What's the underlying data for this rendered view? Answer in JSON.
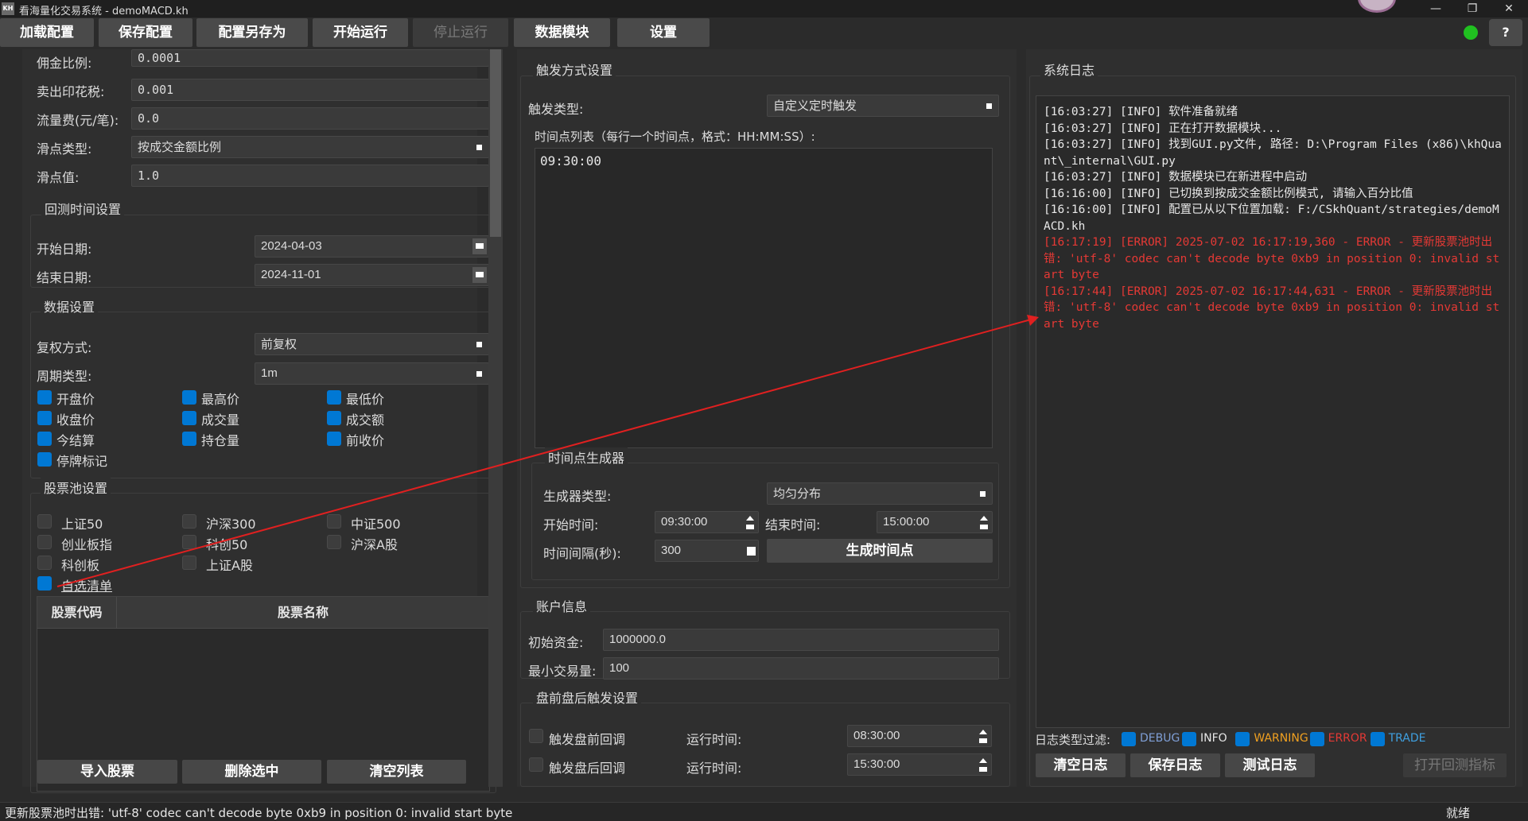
{
  "window": {
    "title": "看海量化交易系统 - demoMACD.kh",
    "app_icon": "KH"
  },
  "toolbar": {
    "load": "加载配置",
    "save": "保存配置",
    "save_as": "配置另存为",
    "start": "开始运行",
    "stop": "停止运行",
    "data": "数据模块",
    "settings": "设置",
    "help": "?",
    "status_color": "#20c020"
  },
  "left": {
    "commission": {
      "label": "佣金比例:",
      "value": "0.0001"
    },
    "stamp_tax": {
      "label": "卖出印花税:",
      "value": "0.001"
    },
    "flow_fee": {
      "label": "流量费(元/笔):",
      "value": "0.0"
    },
    "slippage_type": {
      "label": "滑点类型:",
      "value": "按成交金额比例"
    },
    "slippage_value": {
      "label": "滑点值:",
      "value": "1.0"
    },
    "backtest_group": "回测时间设置",
    "start_date": {
      "label": "开始日期:",
      "value": "2024-04-03"
    },
    "end_date": {
      "label": "结束日期:",
      "value": "2024-11-01"
    },
    "data_group": "数据设置",
    "adjust": {
      "label": "复权方式:",
      "value": "前复权"
    },
    "period": {
      "label": "周期类型:",
      "value": "1m"
    },
    "fields": [
      "开盘价",
      "最高价",
      "最低价",
      "收盘价",
      "成交量",
      "成交额",
      "今结算",
      "持仓量",
      "前收价",
      "停牌标记"
    ],
    "pool_group": "股票池设置",
    "pools": [
      "上证50",
      "沪深300",
      "中证500",
      "创业板指",
      "科创50",
      "沪深A股",
      "科创板",
      "上证A股",
      "自选清单"
    ],
    "table_headers": [
      "股票代码",
      "股票名称"
    ],
    "import": "导入股票",
    "delete": "删除选中",
    "clear": "清空列表"
  },
  "middle": {
    "trigger_group": "触发方式设置",
    "trigger_type": {
      "label": "触发类型:",
      "value": "自定义定时触发"
    },
    "time_list_label": "时间点列表（每行一个时间点，格式：HH:MM:SS）:",
    "time_list_value": "09:30:00",
    "gen_group": "时间点生成器",
    "gen_type": {
      "label": "生成器类型:",
      "value": "均匀分布"
    },
    "gen_start": {
      "label": "开始时间:",
      "value": "09:30:00"
    },
    "gen_end": {
      "label": "结束时间:",
      "value": "15:00:00"
    },
    "gen_interval": {
      "label": "时间间隔(秒):",
      "value": "300"
    },
    "gen_button": "生成时间点",
    "account_group": "账户信息",
    "capital": {
      "label": "初始资金:",
      "value": "1000000.0"
    },
    "min_trade": {
      "label": "最小交易量:",
      "value": "100"
    },
    "prepost_group": "盘前盘后触发设置",
    "pre": {
      "label": "触发盘前回调",
      "time_label": "运行时间:",
      "time": "08:30:00"
    },
    "post": {
      "label": "触发盘后回调",
      "time_label": "运行时间:",
      "time": "15:30:00"
    }
  },
  "right": {
    "log_group": "系统日志",
    "logs": [
      {
        "text": "[16:03:27] [INFO] 软件准备就绪",
        "level": "info"
      },
      {
        "text": "[16:03:27] [INFO] 正在打开数据模块...",
        "level": "info"
      },
      {
        "text": "[16:03:27] [INFO] 找到GUI.py文件, 路径: D:\\Program Files (x86)\\khQuant\\_internal\\GUI.py",
        "level": "info"
      },
      {
        "text": "[16:03:27] [INFO] 数据模块已在新进程中启动",
        "level": "info"
      },
      {
        "text": "[16:16:00] [INFO] 已切换到按成交金额比例模式, 请输入百分比值",
        "level": "info"
      },
      {
        "text": "[16:16:00] [INFO] 配置已从以下位置加载: F:/CSkhQuant/strategies/demoMACD.kh",
        "level": "info"
      },
      {
        "text": "[16:17:19] [ERROR] 2025-07-02 16:17:19,360 - ERROR - 更新股票池时出错: 'utf-8' codec can't decode byte 0xb9 in position 0: invalid start byte",
        "level": "error"
      },
      {
        "text": "[16:17:44] [ERROR] 2025-07-02 16:17:44,631 - ERROR - 更新股票池时出错: 'utf-8' codec can't decode byte 0xb9 in position 0: invalid start byte",
        "level": "error"
      }
    ],
    "filter_label": "日志类型过滤:",
    "filters": [
      {
        "name": "DEBUG",
        "color": "#7f9fd6"
      },
      {
        "name": "INFO",
        "color": "#e6e6e6"
      },
      {
        "name": "WARNING",
        "color": "#f0a020"
      },
      {
        "name": "ERROR",
        "color": "#e53935"
      },
      {
        "name": "TRADE",
        "color": "#3fa0e0"
      }
    ],
    "clear": "清空日志",
    "save": "保存日志",
    "test": "测试日志",
    "open_indicator": "打开回测指标"
  },
  "statusbar": {
    "message": "更新股票池时出错: 'utf-8' codec can't decode byte 0xb9 in position 0: invalid start byte",
    "state": "就绪"
  }
}
